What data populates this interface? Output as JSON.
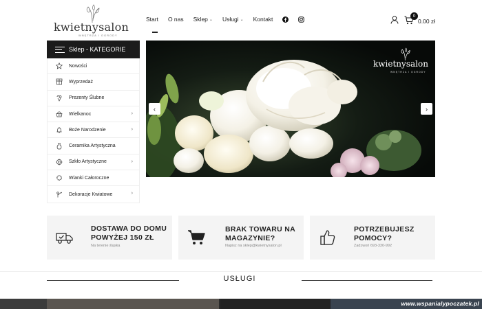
{
  "brand": {
    "name": "kwietnysalon",
    "tagline": "WNĘTRZA I OGRODY"
  },
  "nav": {
    "items": [
      {
        "label": "Start",
        "has_dropdown": false
      },
      {
        "label": "O nas",
        "has_dropdown": false
      },
      {
        "label": "Sklep",
        "has_dropdown": true
      },
      {
        "label": "Usługi",
        "has_dropdown": true
      },
      {
        "label": "Kontakt",
        "has_dropdown": false
      }
    ],
    "social": [
      "facebook-icon",
      "instagram-icon"
    ]
  },
  "cart": {
    "count": "0",
    "total": "0.00 zł"
  },
  "sidebar": {
    "title": "Sklep - KATEGORIE",
    "items": [
      {
        "label": "Nowości",
        "icon": "star-icon",
        "has_sub": false
      },
      {
        "label": "Wyprzedaż",
        "icon": "sale-icon",
        "has_sub": false
      },
      {
        "label": "Prezenty Ślubne",
        "icon": "gift-icon",
        "has_sub": false
      },
      {
        "label": "Wielkanoc",
        "icon": "basket-icon",
        "has_sub": true
      },
      {
        "label": "Boże Narodzenie",
        "icon": "bell-icon",
        "has_sub": true
      },
      {
        "label": "Ceramika Artystyczna",
        "icon": "vase-icon",
        "has_sub": false
      },
      {
        "label": "Szkło Artystyczne",
        "icon": "glass-icon",
        "has_sub": true
      },
      {
        "label": "Wianki Całoroczne",
        "icon": "wreath-icon",
        "has_sub": false
      },
      {
        "label": "Dekoracje Kwiatowe",
        "icon": "flower-icon",
        "has_sub": true
      }
    ]
  },
  "slider": {
    "logo_text": "kwietnysalon",
    "logo_sub": "WNĘTRZA I OGRODY"
  },
  "features": [
    {
      "title": "DOSTAWA DO DOMU POWYŻEJ 150 ZŁ",
      "subtitle": "Na terenie śląska",
      "icon": "truck-icon"
    },
    {
      "title": "BRAK TOWARU NA MAGAZYNIE?",
      "subtitle": "Napisz na sklep@kwietnysalon.pl",
      "icon": "cart-icon"
    },
    {
      "title": "POTRZEBUJESZ POMOCY?",
      "subtitle": "Zadzwoń 693-330-992",
      "icon": "thumbs-up-icon"
    }
  ],
  "services": {
    "title": "USŁUGI"
  },
  "watermark": "www.wspanialypoczatek.pl",
  "colors": {
    "sidebar_header": "#1b1b1b",
    "feature_bg": "#f4f4f4",
    "text": "#222222"
  }
}
